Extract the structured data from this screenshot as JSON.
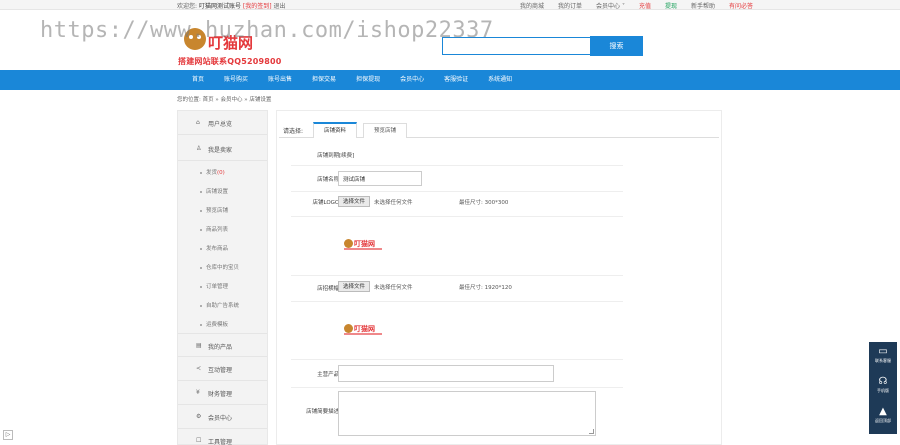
{
  "topbar": {
    "welcome": "欢迎您:",
    "username": "叮猫网测试账号",
    "points": "[我的签到]",
    "logout": "退出",
    "links": [
      "我的商城",
      "我的订单",
      "会员中心 ˅",
      "充值",
      "提现",
      "新手帮助",
      "有问必答"
    ]
  },
  "header": {
    "brand": "叮猫网",
    "phone": "搭建网站联系QQ5209800",
    "watermark": "https://www.huzhan.com/ishop22337",
    "search_button": "搜索",
    "search_placeholder": ""
  },
  "nav": {
    "items": [
      "首页",
      "账号购买",
      "账号出售",
      "担保交易",
      "担保提现",
      "会员中心",
      "客服验证",
      "系统通知"
    ]
  },
  "breadcrumb": "您的位置: 首页 » 会员中心 » 店铺设置",
  "sidebar": {
    "sections": [
      {
        "icon": "⌂",
        "label": "用户总览"
      },
      {
        "icon": "♙",
        "label": "我是卖家"
      },
      {
        "icon": "▤",
        "label": "我的产品"
      },
      {
        "icon": "≺",
        "label": "互动管理"
      },
      {
        "icon": "¥",
        "label": "财务管理"
      },
      {
        "icon": "⚙",
        "label": "会员中心"
      },
      {
        "icon": "☐",
        "label": "工具管理"
      }
    ],
    "seller_items": [
      {
        "label": "发货",
        "count": "(0)"
      },
      {
        "label": "店铺设置",
        "count": ""
      },
      {
        "label": "预览店铺",
        "count": ""
      },
      {
        "label": "商品列表",
        "count": ""
      },
      {
        "label": "发布商品",
        "count": ""
      },
      {
        "label": "仓库中的宝贝",
        "count": ""
      },
      {
        "label": "订单管理",
        "count": ""
      },
      {
        "label": "自助广告系统",
        "count": ""
      },
      {
        "label": "运费模板",
        "count": ""
      }
    ]
  },
  "main": {
    "tab_prefix": "请选择:",
    "tabs": [
      "店铺资料",
      "预览店铺"
    ],
    "form": {
      "expire_label": "店铺到期:",
      "expire_value": "[续费]",
      "name_label": "店铺名称:",
      "name_value": "测试店铺",
      "logo_label": "店铺LOGO:",
      "banner_label": "店招横幅:",
      "file_button": "选择文件",
      "file_none": "未选择任何文件",
      "logo_size": "最佳尺寸: 300*300",
      "banner_size": "最佳尺寸: 1920*120",
      "products_label": "主营产品:",
      "products_value": "",
      "desc_label": "店铺简要描述:",
      "preview_brand": "叮猫网"
    }
  },
  "float_bar": [
    {
      "icon": "▭",
      "label": "联系客服"
    },
    {
      "icon": "☊",
      "label": "手机版"
    },
    {
      "icon": "▲",
      "label": "返回顶部"
    }
  ],
  "corner_icon": "▷"
}
